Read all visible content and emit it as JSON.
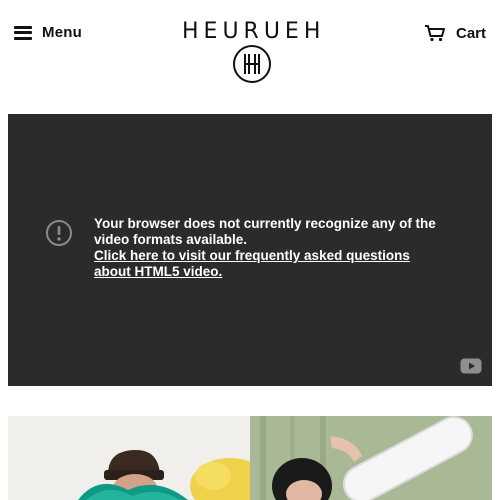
{
  "header": {
    "menu_label": "Menu",
    "brand_name": "HEURUEH",
    "cart_label": "Cart"
  },
  "video": {
    "message_line": "Your browser does not currently recognize any of the video formats available.",
    "help_link": "Click here to visit our frequently asked questions about HTML5 video.",
    "background_color": "#2b2b2b"
  },
  "icons": {
    "menu": "hamburger-icon",
    "cart": "cart-icon",
    "alert": "alert-circle-icon",
    "video_brand": "youtube-icon"
  }
}
